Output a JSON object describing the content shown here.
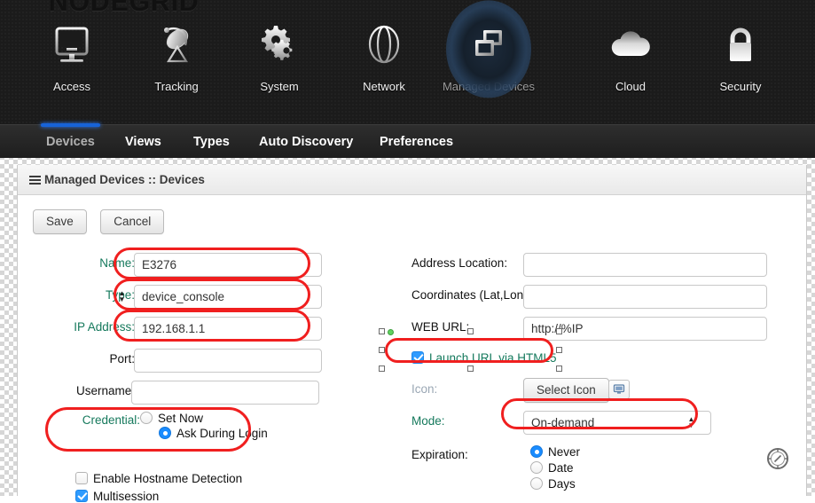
{
  "brand": {
    "logo_text": "NODEGRID"
  },
  "topnav": {
    "items": [
      {
        "label": "Access",
        "icon": "monitor-icon",
        "active": false
      },
      {
        "label": "Tracking",
        "icon": "satellite-dish-icon",
        "active": false
      },
      {
        "label": "System",
        "icon": "gears-icon",
        "active": false
      },
      {
        "label": "Network",
        "icon": "globe-icon",
        "active": false
      },
      {
        "label": "Managed Devices",
        "icon": "windows-stack-icon",
        "active": true
      },
      {
        "label": "Cloud",
        "icon": "cloud-icon",
        "active": false
      },
      {
        "label": "Security",
        "icon": "padlock-icon",
        "active": false
      }
    ]
  },
  "subnav": {
    "tabs": [
      {
        "label": "Devices",
        "active": true
      },
      {
        "label": "Views",
        "active": false
      },
      {
        "label": "Types",
        "active": false
      },
      {
        "label": "Auto Discovery",
        "active": false
      },
      {
        "label": "Preferences",
        "active": false
      }
    ]
  },
  "panel": {
    "title": "Managed Devices :: Devices",
    "menu_icon": "hamburger-icon"
  },
  "toolbar": {
    "save_label": "Save",
    "cancel_label": "Cancel"
  },
  "form": {
    "left": {
      "name": {
        "label": "Name:",
        "value": "E3276"
      },
      "type": {
        "label": "Type:",
        "value": "device_console",
        "options": [
          "device_console"
        ]
      },
      "ip": {
        "label": "IP Address:",
        "value": "192.168.1.1"
      },
      "port": {
        "label": "Port:",
        "value": ""
      },
      "username": {
        "label": "Username:",
        "value": ""
      },
      "credential": {
        "label": "Credential:",
        "options": [
          {
            "label": "Set Now",
            "selected": false
          },
          {
            "label": "Ask During Login",
            "selected": true
          }
        ]
      },
      "checkboxes": [
        {
          "label": "Enable Hostname Detection",
          "checked": false
        },
        {
          "label": "Multisession",
          "checked": true
        }
      ]
    },
    "right": {
      "address_location": {
        "label": "Address Location:",
        "value": ""
      },
      "coordinates": {
        "label": "Coordinates (Lat,Lon):",
        "value": ""
      },
      "web_url": {
        "label": "WEB URL:",
        "value": "http://%IP"
      },
      "launch_html5": {
        "label": "Launch URL via HTML5",
        "checked": true
      },
      "icon": {
        "label": "Icon:",
        "button_label": "Select Icon",
        "preview_icon": "monitor-icon"
      },
      "mode": {
        "label": "Mode:",
        "value": "On-demand",
        "options": [
          "On-demand"
        ]
      },
      "expiration": {
        "label": "Expiration:",
        "options": [
          {
            "label": "Never",
            "selected": true
          },
          {
            "label": "Date",
            "selected": false
          },
          {
            "label": "Days",
            "selected": false
          }
        ]
      },
      "compass_icon": "compass-icon"
    }
  },
  "annotations": {
    "highlight_color": "#f01f1f",
    "selection_handle_color": "#ffffff",
    "anchor_dot_color": "#5fd25f"
  }
}
